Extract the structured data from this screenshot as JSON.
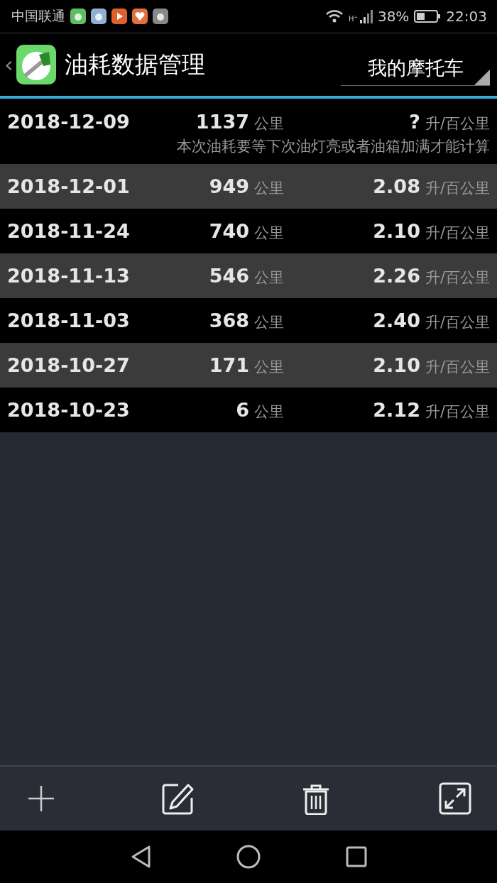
{
  "status_bar": {
    "carrier": "中国联通",
    "battery": "38%",
    "time": "22:03",
    "network": "H⁺"
  },
  "header": {
    "back": "‹",
    "title": "油耗数据管理",
    "vehicle": "我的摩托车"
  },
  "records": [
    {
      "date": "2018-12-09",
      "distance": "1137",
      "distance_unit": "公里",
      "consumption": "?",
      "consumption_unit": "升/百公里",
      "note": "本次油耗要等下次油灯亮或者油箱加满才能计算"
    },
    {
      "date": "2018-12-01",
      "distance": "949",
      "distance_unit": "公里",
      "consumption": "2.08",
      "consumption_unit": "升/百公里"
    },
    {
      "date": "2018-11-24",
      "distance": "740",
      "distance_unit": "公里",
      "consumption": "2.10",
      "consumption_unit": "升/百公里"
    },
    {
      "date": "2018-11-13",
      "distance": "546",
      "distance_unit": "公里",
      "consumption": "2.26",
      "consumption_unit": "升/百公里"
    },
    {
      "date": "2018-11-03",
      "distance": "368",
      "distance_unit": "公里",
      "consumption": "2.40",
      "consumption_unit": "升/百公里"
    },
    {
      "date": "2018-10-27",
      "distance": "171",
      "distance_unit": "公里",
      "consumption": "2.10",
      "consumption_unit": "升/百公里"
    },
    {
      "date": "2018-10-23",
      "distance": "6",
      "distance_unit": "公里",
      "consumption": "2.12",
      "consumption_unit": "升/百公里"
    }
  ],
  "toolbar": [
    {
      "kind": "add"
    },
    {
      "kind": "edit"
    },
    {
      "kind": "delete"
    },
    {
      "kind": "expand"
    }
  ]
}
